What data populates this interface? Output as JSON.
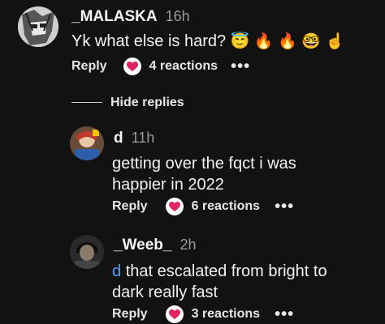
{
  "comments": [
    {
      "username": "_MALASKA",
      "time": "16h",
      "text": "Yk what else is hard?",
      "emojis": [
        "😇",
        "🔥",
        "🔥",
        "🤓",
        "☝️"
      ],
      "reply_label": "Reply",
      "reactions": "4 reactions",
      "more": "•••"
    },
    {
      "username": "d",
      "time": "11h",
      "text": "getting over the fqct i was happier in 2022",
      "reply_label": "Reply",
      "reactions": "6 reactions",
      "more": "•••"
    },
    {
      "username": "_Weeb_",
      "time": "2h",
      "mention": "d",
      "text": "that escalated from bright to dark really fast",
      "reply_label": "Reply",
      "reactions": "3 reactions",
      "more": "•••"
    }
  ],
  "hide_replies": "Hide replies",
  "colors": {
    "background": "#121212",
    "mention": "#4da3ff",
    "reaction_heart": "#e0245e"
  }
}
